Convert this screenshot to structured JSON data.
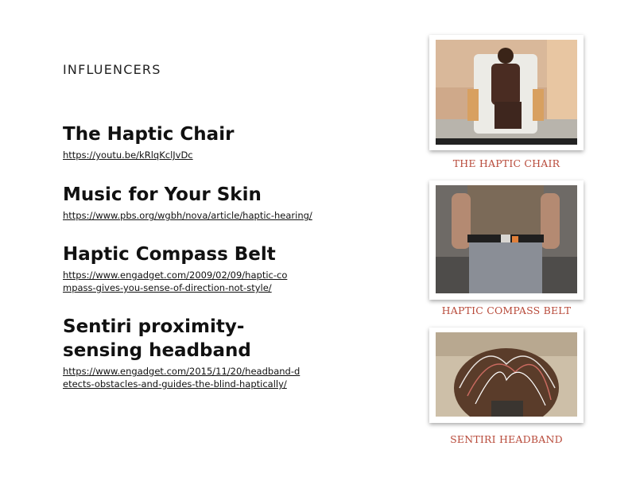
{
  "slide": {
    "section_label": "INFLUENCERS"
  },
  "influencers": [
    {
      "title": "The Haptic Chair",
      "link": "https://youtu.be/kRlqKclJvDc"
    },
    {
      "title": "Music for Your Skin",
      "link": "https://www.pbs.org/wgbh/nova/article/haptic-hearing/"
    },
    {
      "title": "Haptic Compass Belt",
      "link": "https://www.engadget.com/2009/02/09/haptic-compass-gives-you-sense-of-direction-not-style/"
    },
    {
      "title": "Sentiri proximity-sensing headband",
      "link": "https://www.engadget.com/2015/11/20/headband-detects-obstacles-and-guides-the-blind-haptically/"
    }
  ],
  "photos": [
    {
      "caption": "THE HAPTIC CHAIR"
    },
    {
      "caption": "HAPTIC COMPASS BELT"
    },
    {
      "caption": "SENTIRI HEADBAND"
    }
  ],
  "colors": {
    "caption": "#b84a3a",
    "text": "#111111",
    "background": "#ffffff"
  }
}
